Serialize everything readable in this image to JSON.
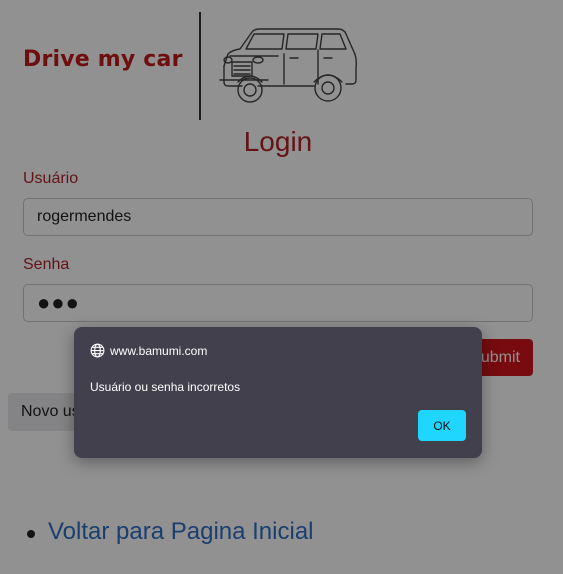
{
  "header": {
    "brand": "Drive my car",
    "logo_icon": "car-icon",
    "brand_color": "#c11a1a"
  },
  "login": {
    "title": "Login",
    "username_label": "Usuário",
    "username_value": "rogermendes",
    "password_label": "Senha",
    "password_masked": "●●●",
    "submit_label": "Submit",
    "new_button_label": "Novo usuário"
  },
  "links": [
    {
      "label": "Voltar para Pagina Inicial"
    }
  ],
  "dialog": {
    "origin": "www.bamumi.com",
    "origin_icon": "globe-icon",
    "message": "Usuário ou senha incorretos",
    "ok_label": "OK",
    "accent_color": "#1fd6ff",
    "background_color": "#41404c"
  },
  "colors": {
    "label_red": "#b0232a",
    "button_red": "#d2141b",
    "link_blue": "#2e6fc4"
  }
}
